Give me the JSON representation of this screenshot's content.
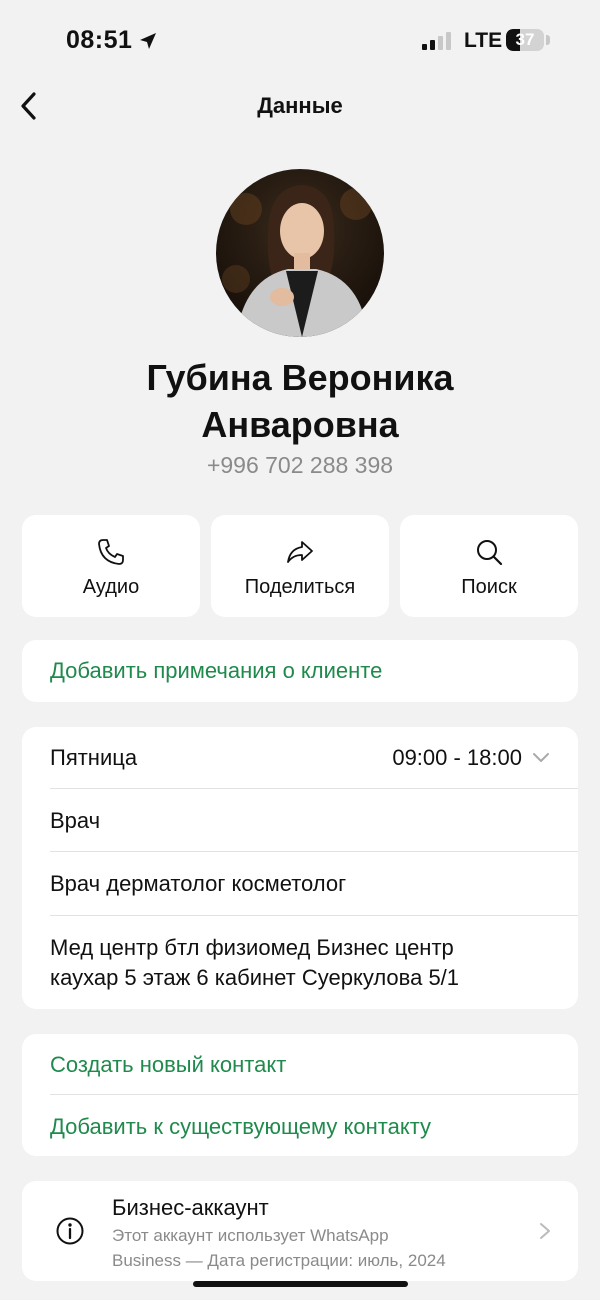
{
  "status_bar": {
    "time": "08:51",
    "network": "LTE",
    "battery": "37",
    "battery_level": 0.37
  },
  "nav": {
    "title": "Данные",
    "back_icon": "chevron-left-icon"
  },
  "contact": {
    "name_line1": "Губина Вероника",
    "name_line2": "Анваровна",
    "phone": "+996 702 288 398"
  },
  "actions": [
    {
      "label": "Аудио",
      "icon": "phone-icon"
    },
    {
      "label": "Поделиться",
      "icon": "share-icon"
    },
    {
      "label": "Поиск",
      "icon": "search-icon"
    }
  ],
  "notes": {
    "add_label": "Добавить примечания о клиенте"
  },
  "business_info": {
    "day": "Пятница",
    "hours": "09:00 - 18:00",
    "category": "Врач",
    "description": "Врач дерматолог косметолог",
    "address_line1": "Мед центр бтл физиомед Бизнес центр",
    "address_line2": "каухар 5 этаж 6 кабинет  Суеркулова 5/1"
  },
  "contact_actions": {
    "create": "Создать новый контакт",
    "add_existing": "Добавить к существующему контакту"
  },
  "business_account": {
    "title": "Бизнес-аккаунт",
    "subtitle_line1": "Этот аккаунт использует WhatsApp",
    "subtitle_line2": "Business — Дата регистрации: июль, 2024"
  },
  "colors": {
    "accent": "#1f8a4c",
    "background": "#f2f2f2",
    "card": "#ffffff",
    "secondary_text": "#8a8a8a"
  }
}
